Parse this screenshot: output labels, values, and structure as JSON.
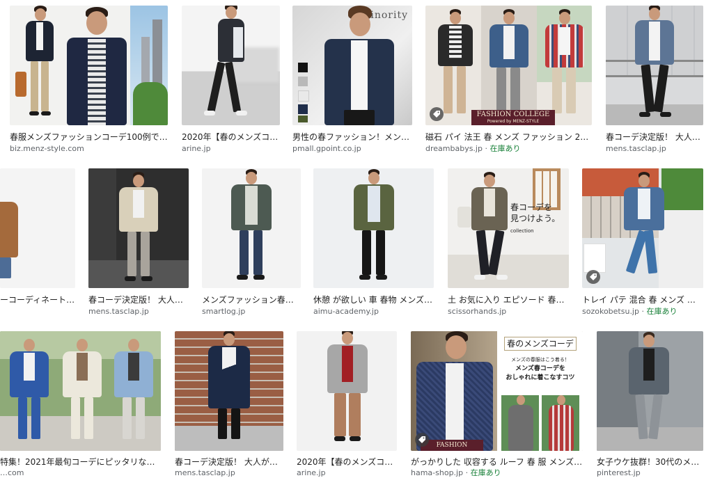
{
  "results": [
    {
      "caption": "春服メンズファッションコーデ100例で…",
      "domain": "biz.menz-style.com"
    },
    {
      "caption": "2020年【春のメンズコ…",
      "domain": "arine.jp"
    },
    {
      "caption": "男性の春ファッション！メン…",
      "domain": "pmall.gpoint.co.jp",
      "watermark": "Minority"
    },
    {
      "caption": "磁石 パイ 法王 春 メンズ ファッション 20…",
      "domain": "dreambabys.jp",
      "stock": "在庫あり",
      "banner": "FASHION COLLEGE",
      "banner_sub": "Powered by MENZ-STYLE"
    },
    {
      "caption": "春コーデ決定版！ 大人…",
      "domain": "mens.tasclap.jp"
    },
    {
      "caption": "ーコーディネート…",
      "domain": ""
    },
    {
      "caption": "春コーデ決定版！ 大人…",
      "domain": "mens.tasclap.jp"
    },
    {
      "caption": "メンズファッション春…",
      "domain": "smartlog.jp"
    },
    {
      "caption": "休憩 が欲しい 車 春物 メンズ …",
      "domain": "aimu-academy.jp"
    },
    {
      "caption": "土 お気に入り エピソード 春…",
      "domain": "scissorhands.jp",
      "overlay_line1": "春コーデを",
      "overlay_line2": "見つけよう。",
      "overlay_brand": "collection"
    },
    {
      "caption": "トレイ パテ 混合 春 メンズ 服…",
      "domain": "sozokobetsu.jp",
      "stock": "在庫あり"
    },
    {
      "caption": "特集！2021年最旬コーデにピッタリなメ…",
      "domain": "…com"
    },
    {
      "caption": "春コーデ決定版！ 大人が…",
      "domain": "mens.tasclap.jp"
    },
    {
      "caption": "2020年【春のメンズコ…",
      "domain": "arine.jp"
    },
    {
      "caption": "がっかりした 収容する ルーフ 春 服 メンズ …",
      "domain": "hama-shop.jp",
      "stock": "在庫あり",
      "title_overlay": "春のメンズコーデ",
      "sub1": "メンズの春服はこう着る！",
      "sub2": "メンズ春コーデを",
      "sub3": "おしゃれに着こなすコツ",
      "banner": "FASHION COLLEGE"
    },
    {
      "caption": "女子ウケ抜群！30代のメ…",
      "domain": "pinterest.jp"
    }
  ],
  "separator": " · ",
  "colors": {
    "caption": "#222222",
    "domain": "#5f6368",
    "stock": "#188038",
    "accent_banner": "#5a1f2b"
  }
}
